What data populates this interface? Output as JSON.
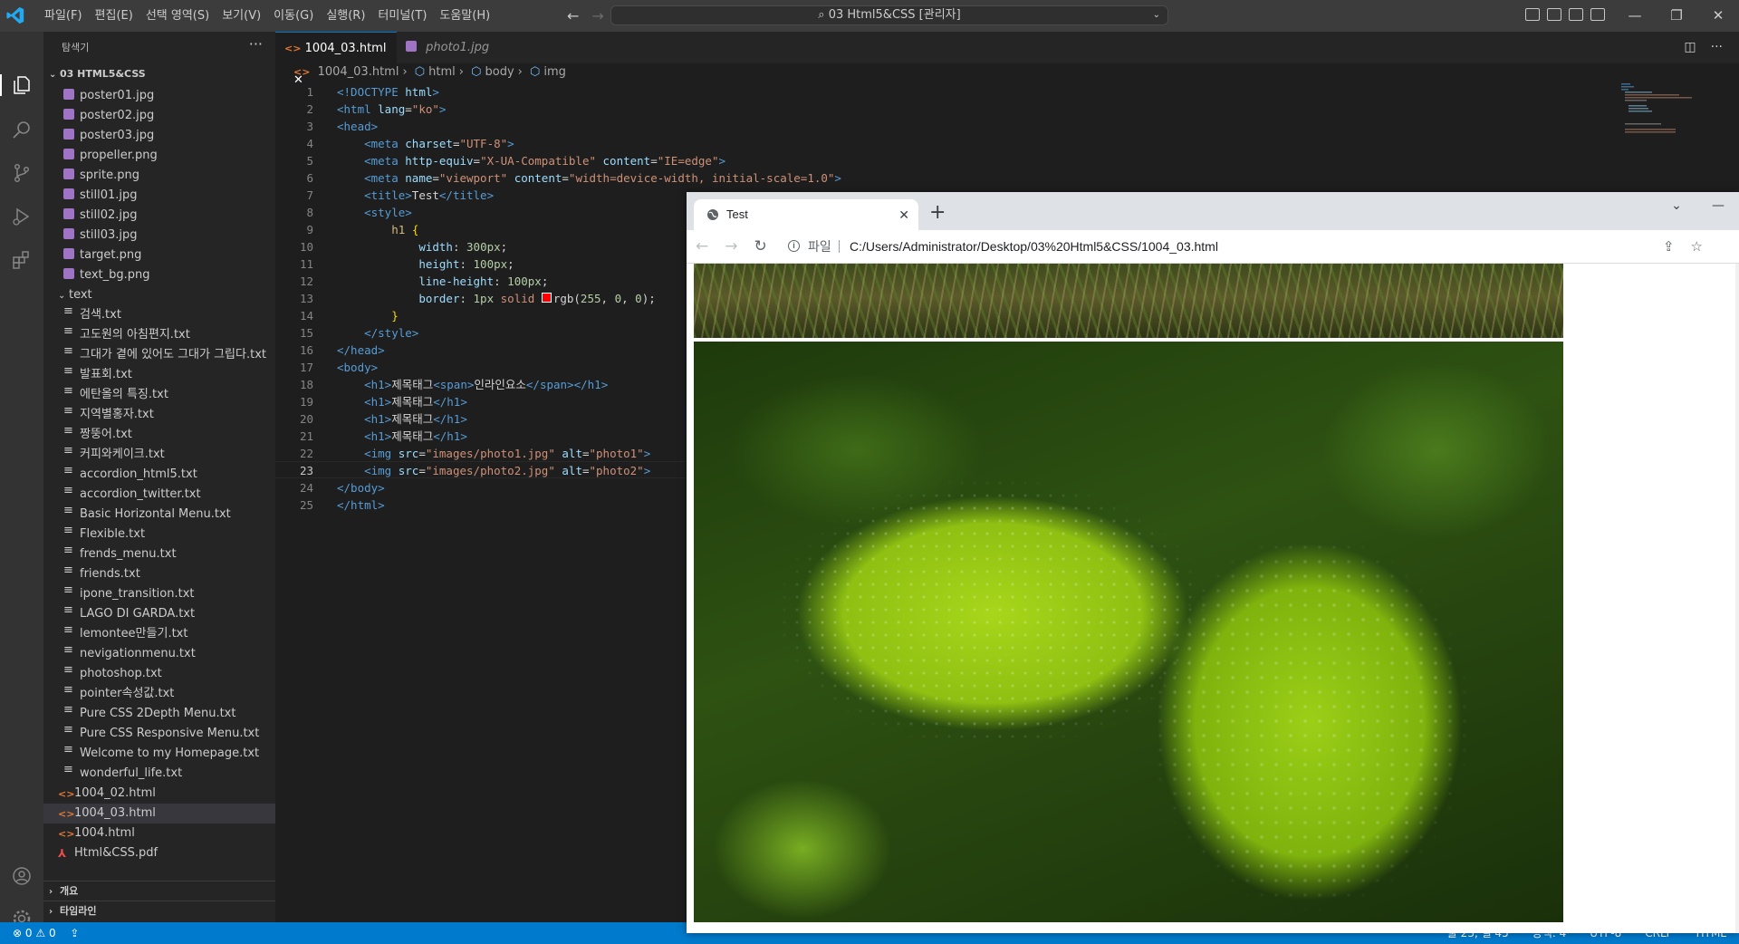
{
  "titlebar": {
    "menus": [
      "파일(F)",
      "편집(E)",
      "선택 영역(S)",
      "보기(V)",
      "이동(G)",
      "실행(R)",
      "터미널(T)",
      "도움말(H)"
    ],
    "command_center": "03 Html5&CSS [관리자]"
  },
  "activity": {
    "icons": [
      "explorer-icon",
      "search-icon",
      "source-control-icon",
      "run-debug-icon",
      "extensions-icon",
      "account-icon",
      "manage-gear-icon"
    ]
  },
  "sidebar": {
    "header": "탐색기",
    "folder": "03 HTML5&CSS",
    "images": [
      "poster01.jpg",
      "poster02.jpg",
      "poster03.jpg",
      "propeller.png",
      "sprite.png",
      "still01.jpg",
      "still02.jpg",
      "still03.jpg",
      "target.png",
      "text_bg.png"
    ],
    "text_folder": "text",
    "texts": [
      "검색.txt",
      "고도원의 아침편지.txt",
      "그대가 곁에 있어도 그대가 그립다.txt",
      "발표회.txt",
      "에탄올의 특징.txt",
      "지역별홍자.txt",
      "짱뚱어.txt",
      "커피와케이크.txt",
      "accordion_html5.txt",
      "accordion_twitter.txt",
      "Basic Horizontal Menu.txt",
      "Flexible.txt",
      "frends_menu.txt",
      "friends.txt",
      "ipone_transition.txt",
      "LAGO DI GARDA.txt",
      "lemontee만들기.txt",
      "nevigationmenu.txt",
      "photoshop.txt",
      "pointer속성값.txt",
      "Pure CSS 2Depth Menu.txt",
      "Pure CSS Responsive Menu.txt",
      "Welcome to my Homepage.txt",
      "wonderful_life.txt"
    ],
    "html_files": [
      "1004_02.html",
      "1004_03.html",
      "1004.html"
    ],
    "pdf_file": "Html&CSS.pdf",
    "outline": "개요",
    "timeline": "타임라인"
  },
  "editor": {
    "tabs": [
      {
        "label": "1004_03.html",
        "active": true
      },
      {
        "label": "photo1.jpg",
        "active": false
      }
    ],
    "breadcrumb": [
      "1004_03.html",
      "html",
      "body",
      "img"
    ],
    "current_line": 23
  },
  "code_lines": [
    [
      [
        "t-tag",
        "<!DOCTYPE "
      ],
      [
        "t-attr",
        "html"
      ],
      [
        "t-tag",
        ">"
      ]
    ],
    [
      [
        "t-tag",
        "<html "
      ],
      [
        "t-attr",
        "lang"
      ],
      [
        "t-txt",
        "="
      ],
      [
        "t-str",
        "\"ko\""
      ],
      [
        "t-tag",
        ">"
      ]
    ],
    [
      [
        "t-tag",
        "<head>"
      ]
    ],
    [
      [
        "t-txt",
        "    "
      ],
      [
        "t-tag",
        "<meta "
      ],
      [
        "t-attr",
        "charset"
      ],
      [
        "t-txt",
        "="
      ],
      [
        "t-str",
        "\"UTF-8\""
      ],
      [
        "t-tag",
        ">"
      ]
    ],
    [
      [
        "t-txt",
        "    "
      ],
      [
        "t-tag",
        "<meta "
      ],
      [
        "t-attr",
        "http-equiv"
      ],
      [
        "t-txt",
        "="
      ],
      [
        "t-str",
        "\"X-UA-Compatible\""
      ],
      [
        "t-txt",
        " "
      ],
      [
        "t-attr",
        "content"
      ],
      [
        "t-txt",
        "="
      ],
      [
        "t-str",
        "\"IE=edge\""
      ],
      [
        "t-tag",
        ">"
      ]
    ],
    [
      [
        "t-txt",
        "    "
      ],
      [
        "t-tag",
        "<meta "
      ],
      [
        "t-attr",
        "name"
      ],
      [
        "t-txt",
        "="
      ],
      [
        "t-str",
        "\"viewport\""
      ],
      [
        "t-txt",
        " "
      ],
      [
        "t-attr",
        "content"
      ],
      [
        "t-txt",
        "="
      ],
      [
        "t-str",
        "\"width=device-width, initial-scale=1.0\""
      ],
      [
        "t-tag",
        ">"
      ]
    ],
    [
      [
        "t-txt",
        "    "
      ],
      [
        "t-tag",
        "<title>"
      ],
      [
        "t-txt",
        "Test"
      ],
      [
        "t-tag",
        "</title>"
      ]
    ],
    [
      [
        "t-txt",
        "    "
      ],
      [
        "t-tag",
        "<style>"
      ]
    ],
    [
      [
        "t-txt",
        "        "
      ],
      [
        "t-sel",
        "h1"
      ],
      [
        "t-txt",
        " "
      ],
      [
        "t-brace",
        "{"
      ]
    ],
    [
      [
        "t-txt",
        "            "
      ],
      [
        "t-prop",
        "width"
      ],
      [
        "t-txt",
        ": "
      ],
      [
        "t-num",
        "300px"
      ],
      [
        "t-txt",
        ";"
      ]
    ],
    [
      [
        "t-txt",
        "            "
      ],
      [
        "t-prop",
        "height"
      ],
      [
        "t-txt",
        ": "
      ],
      [
        "t-num",
        "100px"
      ],
      [
        "t-txt",
        ";"
      ]
    ],
    [
      [
        "t-txt",
        "            "
      ],
      [
        "t-prop",
        "line-height"
      ],
      [
        "t-txt",
        ": "
      ],
      [
        "t-num",
        "100px"
      ],
      [
        "t-txt",
        ";"
      ]
    ],
    [
      [
        "t-txt",
        "            "
      ],
      [
        "t-prop",
        "border"
      ],
      [
        "t-txt",
        ": "
      ],
      [
        "t-num",
        "1px"
      ],
      [
        "t-txt",
        " "
      ],
      [
        "t-val",
        "solid"
      ],
      [
        "t-txt",
        " "
      ],
      [
        "swatch",
        ""
      ],
      [
        "t-txt",
        "rgb("
      ],
      [
        "t-num",
        "255"
      ],
      [
        "t-txt",
        ", "
      ],
      [
        "t-num",
        "0"
      ],
      [
        "t-txt",
        ", "
      ],
      [
        "t-num",
        "0"
      ],
      [
        "t-txt",
        ");"
      ]
    ],
    [
      [
        "t-txt",
        "        "
      ],
      [
        "t-brace",
        "}"
      ]
    ],
    [
      [
        "t-txt",
        "    "
      ],
      [
        "t-tag",
        "</style>"
      ]
    ],
    [
      [
        "t-tag",
        "</head>"
      ]
    ],
    [
      [
        "t-tag",
        "<body>"
      ]
    ],
    [
      [
        "t-txt",
        "    "
      ],
      [
        "t-tag",
        "<h1>"
      ],
      [
        "t-txt",
        "제목태그"
      ],
      [
        "t-tag",
        "<span>"
      ],
      [
        "t-txt",
        "인라인요소"
      ],
      [
        "t-tag",
        "</span></h1>"
      ]
    ],
    [
      [
        "t-txt",
        "    "
      ],
      [
        "t-tag",
        "<h1>"
      ],
      [
        "t-txt",
        "제목태그"
      ],
      [
        "t-tag",
        "</h1>"
      ]
    ],
    [
      [
        "t-txt",
        "    "
      ],
      [
        "t-tag",
        "<h1>"
      ],
      [
        "t-txt",
        "제목태그"
      ],
      [
        "t-tag",
        "</h1>"
      ]
    ],
    [
      [
        "t-txt",
        "    "
      ],
      [
        "t-tag",
        "<h1>"
      ],
      [
        "t-txt",
        "제목태그"
      ],
      [
        "t-tag",
        "</h1>"
      ]
    ],
    [
      [
        "t-txt",
        "    "
      ],
      [
        "t-tag",
        "<img "
      ],
      [
        "t-attr",
        "src"
      ],
      [
        "t-txt",
        "="
      ],
      [
        "t-str",
        "\"images/photo1.jpg\""
      ],
      [
        "t-txt",
        " "
      ],
      [
        "t-attr",
        "alt"
      ],
      [
        "t-txt",
        "="
      ],
      [
        "t-str",
        "\"photo1\""
      ],
      [
        "t-tag",
        ">"
      ]
    ],
    [
      [
        "t-txt",
        "    "
      ],
      [
        "t-tag",
        "<img "
      ],
      [
        "t-attr",
        "src"
      ],
      [
        "t-txt",
        "="
      ],
      [
        "t-str",
        "\"images/photo2.jpg\""
      ],
      [
        "t-txt",
        " "
      ],
      [
        "t-attr",
        "alt"
      ],
      [
        "t-txt",
        "="
      ],
      [
        "t-str",
        "\"photo2\""
      ],
      [
        "t-tag",
        ">"
      ]
    ],
    [
      [
        "t-tag",
        "</body>"
      ]
    ],
    [
      [
        "t-tag",
        "</html>"
      ]
    ]
  ],
  "statusbar": {
    "errors": "0",
    "warnings": "0",
    "right_items": [
      "줄 23, 열 45",
      "공백: 4",
      "UTF-8",
      "CRLF",
      "HTML"
    ]
  },
  "browser": {
    "tab_title": "Test",
    "scheme_label": "파일",
    "url": "C:/Users/Administrator/Desktop/03%20Html5&CSS/1004_03.html",
    "images": [
      "photo1",
      "photo2"
    ]
  }
}
